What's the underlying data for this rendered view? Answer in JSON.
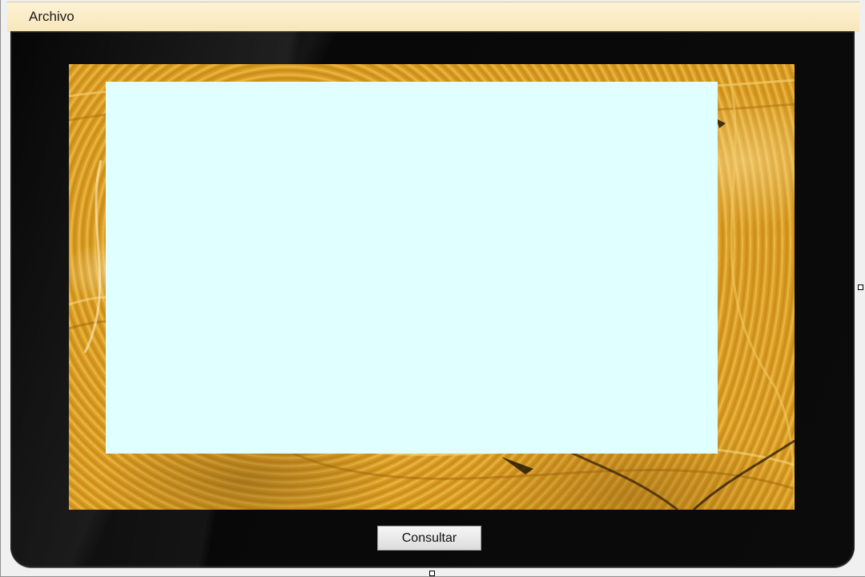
{
  "menubar": {
    "items": [
      {
        "label": "Archivo"
      }
    ]
  },
  "actions": {
    "consultar_label": "Consultar"
  },
  "colors": {
    "menubar_bg": "#f9ecc6",
    "tablet_frame": "#0a0a0a",
    "content_panel": "#e0ffff",
    "wallpaper_gold": "#d49a24",
    "button_face": "#e8e8e8"
  },
  "icons": {
    "wallpaper": "golden-swirl-texture",
    "resize_handles": "designer-resize-handle"
  }
}
